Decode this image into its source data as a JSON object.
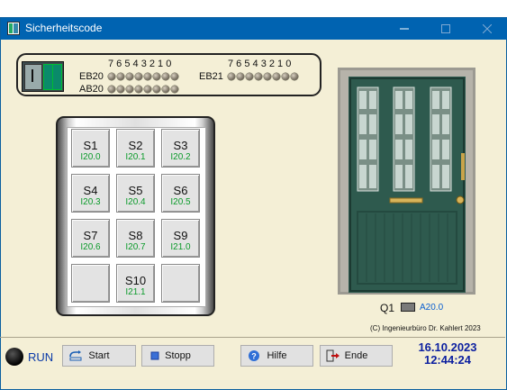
{
  "window": {
    "title": "Sicherheitscode"
  },
  "io_panel": {
    "bit_numbers": "7 6 5 4 3 2 1 0",
    "eb20_label": "EB20",
    "ab20_label": "AB20",
    "eb21_label": "EB21"
  },
  "keypad": {
    "keys": [
      {
        "label": "S1",
        "addr": "I20.0"
      },
      {
        "label": "S2",
        "addr": "I20.1"
      },
      {
        "label": "S3",
        "addr": "I20.2"
      },
      {
        "label": "S4",
        "addr": "I20.3"
      },
      {
        "label": "S5",
        "addr": "I20.4"
      },
      {
        "label": "S6",
        "addr": "I20.5"
      },
      {
        "label": "S7",
        "addr": "I20.6"
      },
      {
        "label": "S8",
        "addr": "I20.7"
      },
      {
        "label": "S9",
        "addr": "I21.0"
      },
      {
        "label": "S10",
        "addr": "I21.1"
      }
    ]
  },
  "output": {
    "label": "Q1",
    "addr": "A20.0"
  },
  "copyright": "(C) Ingenieurbüro Dr. Kahlert 2023",
  "status": {
    "run_label": "RUN"
  },
  "buttons": {
    "start": "Start",
    "stopp": "Stopp",
    "hilfe": "Hilfe",
    "ende": "Ende"
  },
  "datetime": {
    "date": "16.10.2023",
    "time": "12:44:24"
  },
  "colors": {
    "title_bar": "#0063b1",
    "background": "#f4efd6",
    "door": "#2e5a4e",
    "address_green": "#0b9a2a",
    "clock_blue": "#0b1fa0"
  }
}
